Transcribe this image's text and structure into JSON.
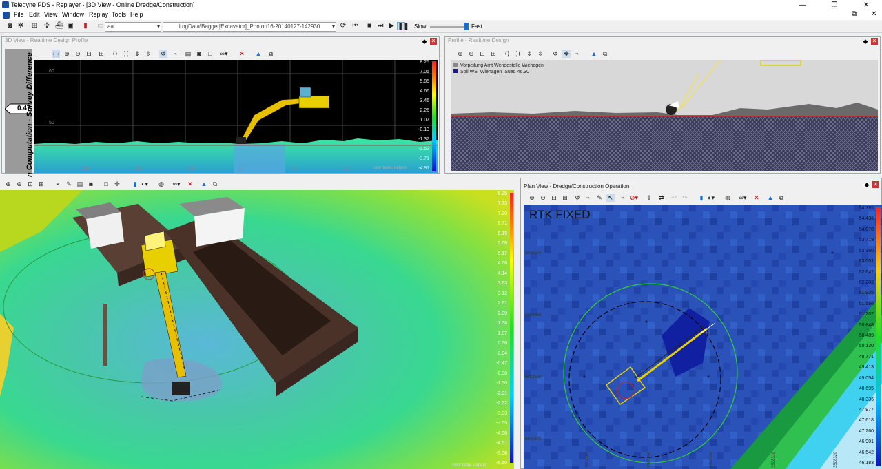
{
  "window": {
    "title": "Teledyne PDS - Replayer - [3D View - Online Dredge/Construction]",
    "minimize": "—",
    "maximize": "❐",
    "close": "✕"
  },
  "menu": [
    "File",
    "Edit",
    "View",
    "Window",
    "Replay",
    "Tools",
    "Help"
  ],
  "toolbar": {
    "profile_combo": "aa",
    "log_file": "LogData\\Bagger[Excavator]_Ponton16-20140127-142930",
    "speed_slow": "Slow",
    "speed_fast": "Fast"
  },
  "panel_3d_profile": {
    "title": "3D View - Realtime Design Profile",
    "vertical_label": "n Computation - Survey Difference",
    "value_badge": "0.47",
    "y_labels": [
      "60",
      "50"
    ],
    "x_labels": [
      "-30",
      "-20",
      "-10",
      "0",
      "10",
      "20"
    ],
    "scale": [
      "8.25",
      "7.05",
      "5.85",
      "4.66",
      "3.46",
      "2.26",
      "1.07",
      "-0.13",
      "-1.32",
      "-2.52",
      "-3.71",
      "-4.91"
    ],
    "color_table": "color table: default"
  },
  "panel_profile": {
    "title": "Profile - Realtime Design",
    "legend": [
      "Vorpeilung Amt Wendestelle Wiehagen",
      "Soll WS_Wiehagen_Sued 46.30"
    ]
  },
  "panel_3d_main": {
    "scale": [
      "8.25",
      "7.73",
      "7.20",
      "6.71",
      "6.19",
      "5.68",
      "5.17",
      "4.66",
      "4.14",
      "3.63",
      "3.12",
      "2.61",
      "2.09",
      "1.58",
      "1.07",
      "0.56",
      "0.04",
      "-0.47",
      "-0.98",
      "-1.50",
      "-2.01",
      "-2.52",
      "-3.03",
      "-3.55",
      "-4.06",
      "-4.57",
      "-5.08",
      "-5.60"
    ],
    "color_table": "color table: default"
  },
  "panel_plan": {
    "title": "Plan View - Dredge/Construction Operation",
    "status": "RTK FIXED",
    "northings": [
      "5802570",
      "5802560",
      "5802550",
      "5802540"
    ],
    "eastings": [
      "3508280",
      "3508290",
      "3508300",
      "3508310",
      "3508320"
    ],
    "scale": [
      "54.795",
      "54.436",
      "54.078",
      "53.719",
      "53.360",
      "53.001",
      "52.642",
      "52.283",
      "51.925",
      "51.566",
      "51.207",
      "50.848",
      "50.489",
      "50.130",
      "49.771",
      "49.413",
      "49.054",
      "48.695",
      "48.336",
      "47.977",
      "47.618",
      "47.260",
      "46.901",
      "46.542",
      "46.183"
    ]
  },
  "colors": {
    "accent": "#1a4fa0",
    "close": "#cc3333",
    "excavator": "#e8d000"
  }
}
